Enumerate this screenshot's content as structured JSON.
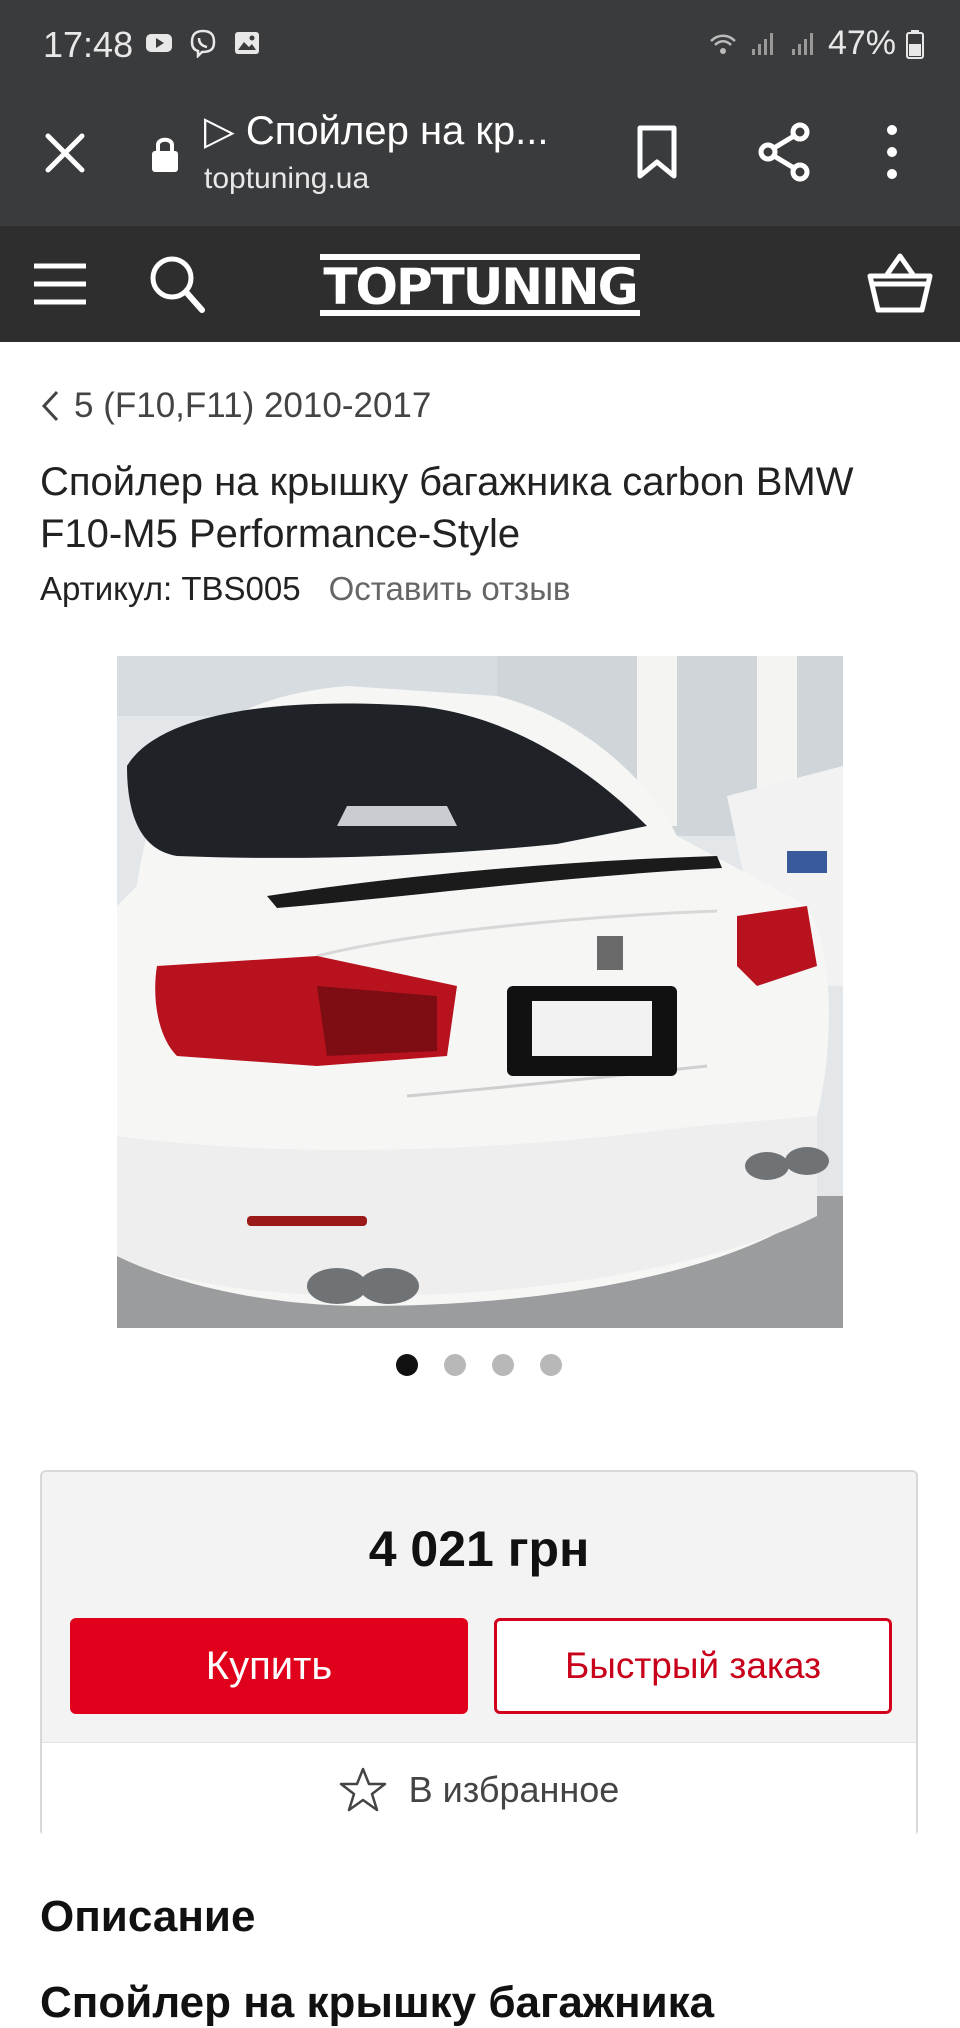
{
  "status_bar": {
    "time": "17:48",
    "battery": "47%",
    "icons": [
      "youtube-icon",
      "viber-icon",
      "gallery-icon",
      "wifi-icon",
      "signal-icon",
      "signal-icon",
      "battery-icon"
    ]
  },
  "browser": {
    "title": "▷ Спойлер на кр...",
    "domain": "toptuning.ua"
  },
  "header": {
    "logo_text": "TOPTUNING",
    "bg_color": "#2e2e2f"
  },
  "breadcrumb": {
    "label": "5 (F10,F11) 2010-2017"
  },
  "product": {
    "title": "Спойлер на крышку багажника carbon BMW F10-M5 Performance-Style",
    "sku": "Артикул: TBS005",
    "review_link": "Оставить отзыв",
    "image_count": 4,
    "active_image": 1
  },
  "buy_box": {
    "price": "4 021 грн",
    "buy_label": "Купить",
    "quick_order_label": "Быстрый заказ",
    "favorite_label": "В избранное",
    "accent_color": "#e0001b"
  },
  "description": {
    "heading": "Описание",
    "title": "Спойлер на крышку багажника"
  }
}
